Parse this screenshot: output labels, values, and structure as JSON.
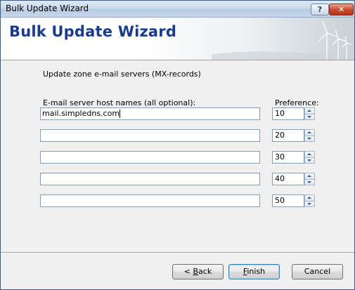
{
  "window": {
    "title": "Bulk Update Wizard",
    "help_label": "?",
    "close_label": "✕"
  },
  "banner": {
    "title": "Bulk Update Wizard"
  },
  "page": {
    "subtitle": "Update zone e-mail servers (MX-records)",
    "hosts_header": "E-mail server host names (all optional):",
    "preference_header": "Preference:"
  },
  "rows": [
    {
      "host": "mail.simpledns.com",
      "preference": "10"
    },
    {
      "host": "",
      "preference": "20"
    },
    {
      "host": "",
      "preference": "30"
    },
    {
      "host": "",
      "preference": "40"
    },
    {
      "host": "",
      "preference": "50"
    }
  ],
  "buttons": {
    "back": {
      "mnemonic": "B",
      "rest": "ack",
      "prefix": "< "
    },
    "finish": {
      "mnemonic": "F",
      "rest": "inish"
    },
    "cancel": "Cancel"
  },
  "colors": {
    "banner_title": "#183b8c",
    "window_border": "#3b5a82",
    "close_button": "#c7482b"
  }
}
